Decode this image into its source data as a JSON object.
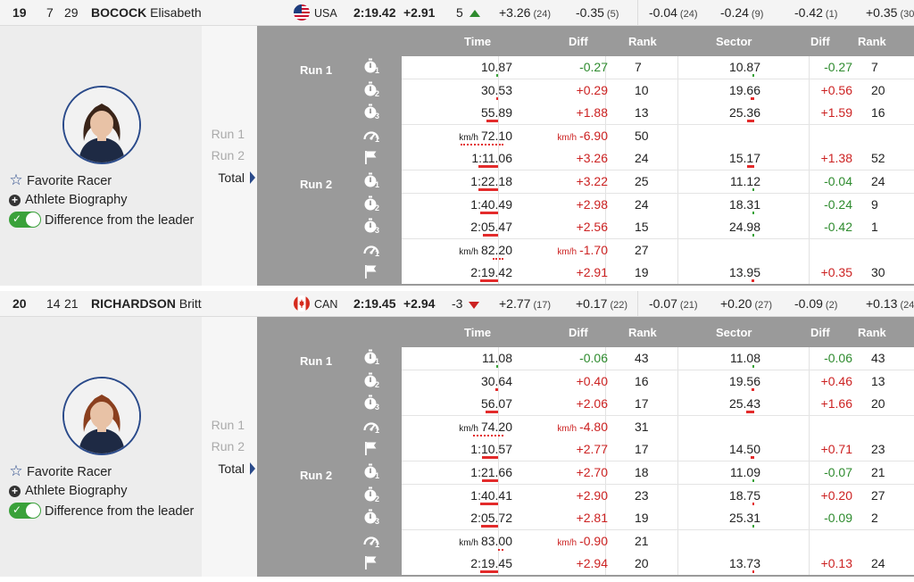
{
  "labels": {
    "time": "Time",
    "diff": "Diff",
    "rank": "Rank",
    "sector": "Sector",
    "sdiff": "Diff",
    "srank": "Rank",
    "run1": "Run 1",
    "run2": "Run 2",
    "total": "Total",
    "favorite": "Favorite Racer",
    "bio": "Athlete Biography",
    "leader": "Difference from the leader",
    "kmh": "km/h"
  },
  "colors": {
    "positive": "#cc2222",
    "negative": "#2e8b2e",
    "toggle": "#3aa13a",
    "accent": "#2a4a8a"
  },
  "athletes": [
    {
      "rank": "19",
      "bib": "7",
      "fis": "29",
      "last_name": "BOCOCK",
      "first_name": "Elisabeth",
      "flag_icon": "usa-flag-icon",
      "nation": "USA",
      "total": "2:19.42",
      "total_diff": "+2.91",
      "rank_change": "5",
      "rank_change_dir": "up",
      "splits": [
        {
          "v": "+3.26",
          "r": "(24)"
        },
        {
          "v": "-0.35",
          "r": "(5)"
        },
        {
          "v": "-0.04",
          "r": "(24)"
        },
        {
          "v": "-0.24",
          "r": "(9)"
        },
        {
          "v": "-0.42",
          "r": "(1)"
        },
        {
          "v": "+0.35",
          "r": "(30)"
        }
      ],
      "rows": [
        {
          "icon": "timer",
          "sub": "1",
          "time": "10.87",
          "diff": "-0.27",
          "rank": "7",
          "sector": "10.87",
          "sdiff": "-0.27",
          "srank": "7",
          "bar": 0,
          "sbar": 0
        },
        {
          "icon": "timer",
          "sub": "2",
          "time": "30.53",
          "diff": "+0.29",
          "rank": "10",
          "sector": "19.66",
          "sdiff": "+0.56",
          "srank": "20",
          "bar": 2,
          "sbar": 4
        },
        {
          "icon": "timer",
          "sub": "3",
          "time": "55.89",
          "diff": "+1.88",
          "rank": "13",
          "sector": "25.36",
          "sdiff": "+1.59",
          "srank": "16",
          "bar": 13,
          "sbar": 8
        },
        {
          "icon": "speed",
          "sub": "1",
          "time": "72.10",
          "diff": "-6.90",
          "rank": "50",
          "sector": "",
          "sdiff": "",
          "srank": "",
          "bar": 48,
          "sbar": 0
        },
        {
          "icon": "flag",
          "sub": "",
          "time": "1:11.06",
          "diff": "+3.26",
          "rank": "24",
          "sector": "15.17",
          "sdiff": "+1.38",
          "srank": "52",
          "bar": 22,
          "sbar": 8
        },
        {
          "icon": "timer",
          "sub": "1",
          "time": "1:22.18",
          "diff": "+3.22",
          "rank": "25",
          "sector": "11.12",
          "sdiff": "-0.04",
          "srank": "24",
          "bar": 22,
          "sbar": 0
        },
        {
          "icon": "timer",
          "sub": "2",
          "time": "1:40.49",
          "diff": "+2.98",
          "rank": "24",
          "sector": "18.31",
          "sdiff": "-0.24",
          "srank": "9",
          "bar": 20,
          "sbar": 0
        },
        {
          "icon": "timer",
          "sub": "3",
          "time": "2:05.47",
          "diff": "+2.56",
          "rank": "15",
          "sector": "24.98",
          "sdiff": "-0.42",
          "srank": "1",
          "bar": 17,
          "sbar": 0
        },
        {
          "icon": "speed",
          "sub": "1",
          "time": "82.20",
          "diff": "-1.70",
          "rank": "27",
          "sector": "",
          "sdiff": "",
          "srank": "",
          "bar": 12,
          "sbar": 0
        },
        {
          "icon": "flag",
          "sub": "",
          "time": "2:19.42",
          "diff": "+2.91",
          "rank": "19",
          "sector": "13.95",
          "sdiff": "+0.35",
          "srank": "30",
          "bar": 20,
          "sbar": 3
        }
      ]
    },
    {
      "rank": "20",
      "bib": "14",
      "fis": "21",
      "last_name": "RICHARDSON",
      "first_name": "Britt",
      "flag_icon": "canada-flag-icon",
      "nation": "CAN",
      "total": "2:19.45",
      "total_diff": "+2.94",
      "rank_change": "-3",
      "rank_change_dir": "down",
      "splits": [
        {
          "v": "+2.77",
          "r": "(17)"
        },
        {
          "v": "+0.17",
          "r": "(22)"
        },
        {
          "v": "-0.07",
          "r": "(21)"
        },
        {
          "v": "+0.20",
          "r": "(27)"
        },
        {
          "v": "-0.09",
          "r": "(2)"
        },
        {
          "v": "+0.13",
          "r": "(24"
        }
      ],
      "rows": [
        {
          "icon": "timer",
          "sub": "1",
          "time": "11.08",
          "diff": "-0.06",
          "rank": "43",
          "sector": "11.08",
          "sdiff": "-0.06",
          "srank": "43",
          "bar": 0,
          "sbar": 0
        },
        {
          "icon": "timer",
          "sub": "2",
          "time": "30.64",
          "diff": "+0.40",
          "rank": "16",
          "sector": "19.56",
          "sdiff": "+0.46",
          "srank": "13",
          "bar": 3,
          "sbar": 3
        },
        {
          "icon": "timer",
          "sub": "3",
          "time": "56.07",
          "diff": "+2.06",
          "rank": "17",
          "sector": "25.43",
          "sdiff": "+1.66",
          "srank": "20",
          "bar": 14,
          "sbar": 9
        },
        {
          "icon": "speed",
          "sub": "1",
          "time": "74.20",
          "diff": "-4.80",
          "rank": "31",
          "sector": "",
          "sdiff": "",
          "srank": "",
          "bar": 34,
          "sbar": 0
        },
        {
          "icon": "flag",
          "sub": "",
          "time": "1:10.57",
          "diff": "+2.77",
          "rank": "17",
          "sector": "14.50",
          "sdiff": "+0.71",
          "srank": "23",
          "bar": 18,
          "sbar": 4
        },
        {
          "icon": "timer",
          "sub": "1",
          "time": "1:21.66",
          "diff": "+2.70",
          "rank": "18",
          "sector": "11.09",
          "sdiff": "-0.07",
          "srank": "21",
          "bar": 18,
          "sbar": 0
        },
        {
          "icon": "timer",
          "sub": "2",
          "time": "1:40.41",
          "diff": "+2.90",
          "rank": "23",
          "sector": "18.75",
          "sdiff": "+0.20",
          "srank": "27",
          "bar": 20,
          "sbar": 2
        },
        {
          "icon": "timer",
          "sub": "3",
          "time": "2:05.72",
          "diff": "+2.81",
          "rank": "19",
          "sector": "25.31",
          "sdiff": "-0.09",
          "srank": "2",
          "bar": 19,
          "sbar": 0
        },
        {
          "icon": "speed",
          "sub": "1",
          "time": "83.00",
          "diff": "-0.90",
          "rank": "21",
          "sector": "",
          "sdiff": "",
          "srank": "",
          "bar": 6,
          "sbar": 0
        },
        {
          "icon": "flag",
          "sub": "",
          "time": "2:19.45",
          "diff": "+2.94",
          "rank": "20",
          "sector": "13.73",
          "sdiff": "+0.13",
          "srank": "24",
          "bar": 20,
          "sbar": 2
        }
      ]
    }
  ]
}
